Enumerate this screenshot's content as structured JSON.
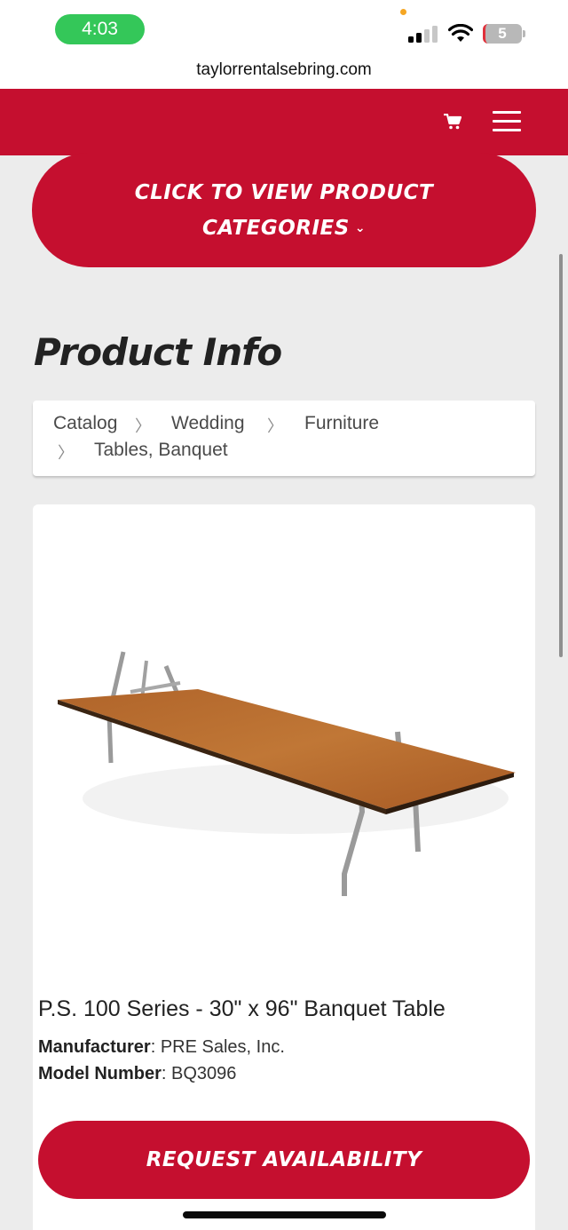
{
  "status_bar": {
    "time": "4:03",
    "battery_level": "5",
    "url": "taylorrentalsebring.com"
  },
  "header": {
    "cart_icon": "cart-icon",
    "menu_icon": "hamburger-menu-icon",
    "brand_color": "#c50f2f"
  },
  "category_button": {
    "line1": "Click to view product",
    "line2": "categories",
    "chevron": "⌄"
  },
  "page": {
    "title": "Product Info"
  },
  "breadcrumb": {
    "separator": "〉",
    "items": [
      "Catalog",
      "Wedding",
      "Furniture",
      "Tables, Banquet"
    ]
  },
  "product": {
    "name": "P.S. 100 Series - 30\" x 96\" Banquet Table",
    "manufacturer_label": "Manufacturer",
    "manufacturer": "PRE Sales, Inc.",
    "model_label": "Model Number",
    "model": "BQ3096",
    "request_label": "Request Availability"
  }
}
